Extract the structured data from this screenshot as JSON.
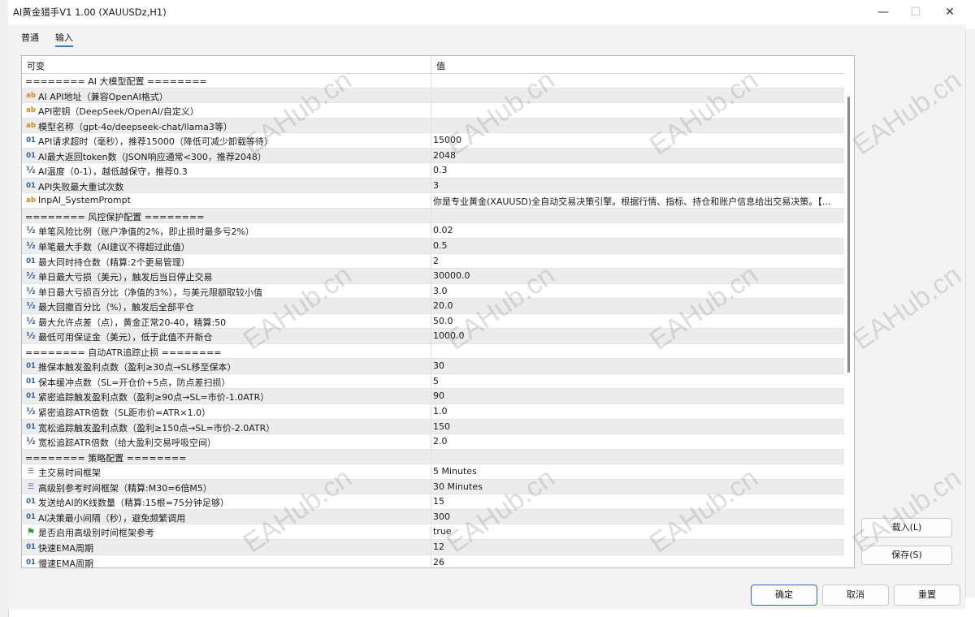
{
  "window": {
    "title": "AI黄金猎手V1 1.00 (XAUUSDz,H1)"
  },
  "tabs": [
    {
      "label": "普通"
    },
    {
      "label": "输入"
    }
  ],
  "grid": {
    "col_name": "可变",
    "col_value": "值",
    "rows": [
      {
        "type": "sep",
        "icon": "",
        "name": "======== AI 大模型配置 ========",
        "value": ""
      },
      {
        "type": "ab",
        "icon": "ab",
        "name": "AI API地址（兼容OpenAI格式）",
        "value": ""
      },
      {
        "type": "ab",
        "icon": "ab",
        "name": "API密钥（DeepSeek/OpenAI/自定义）",
        "value": ""
      },
      {
        "type": "ab",
        "icon": "ab",
        "name": "模型名称（gpt-4o/deepseek-chat/llama3等）",
        "value": ""
      },
      {
        "type": "n01",
        "icon": "01",
        "name": "API请求超时（毫秒），推荐15000（降低可减少卸载等待）",
        "value": "15000"
      },
      {
        "type": "n01",
        "icon": "01",
        "name": "AI最大返回token数（JSON响应通常<300，推荐2048）",
        "value": "2048"
      },
      {
        "type": "half",
        "icon": "½",
        "name": "AI温度（0-1），越低越保守，推荐0.3",
        "value": "0.3"
      },
      {
        "type": "n01",
        "icon": "01",
        "name": "API失败最大重试次数",
        "value": "3"
      },
      {
        "type": "ab",
        "icon": "ab",
        "name": "InpAI_SystemPrompt",
        "value": "你是专业黄金(XAUUSD)全自动交易决策引擎。根据行情、指标、持仓和账户信息给出交易决策。【..."
      },
      {
        "type": "sep",
        "icon": "",
        "name": "======== 风控保护配置 ========",
        "value": ""
      },
      {
        "type": "half",
        "icon": "½",
        "name": "单笔风险比例（账户净值的2%，即止损时最多亏2%）",
        "value": "0.02"
      },
      {
        "type": "half",
        "icon": "½",
        "name": "单笔最大手数（AI建议不得超过此值）",
        "value": "0.5"
      },
      {
        "type": "n01",
        "icon": "01",
        "name": "最大同时持仓数（精算:2个更易管理）",
        "value": "2"
      },
      {
        "type": "half",
        "icon": "½",
        "name": "单日最大亏损（美元），触发后当日停止交易",
        "value": "30000.0"
      },
      {
        "type": "half",
        "icon": "½",
        "name": "单日最大亏损百分比（净值的3%），与美元限额取较小值",
        "value": "3.0"
      },
      {
        "type": "half",
        "icon": "½",
        "name": "最大回撤百分比（%），触发后全部平仓",
        "value": "20.0"
      },
      {
        "type": "half",
        "icon": "½",
        "name": "最大允许点差（点），黄金正常20-40，精算:50",
        "value": "50.0"
      },
      {
        "type": "half",
        "icon": "½",
        "name": "最低可用保证金（美元），低于此值不开新仓",
        "value": "1000.0"
      },
      {
        "type": "sep",
        "icon": "",
        "name": "======== 自动ATR追踪止损 ========",
        "value": ""
      },
      {
        "type": "n01",
        "icon": "01",
        "name": "推保本触发盈利点数（盈利≥30点→SL移至保本）",
        "value": "30"
      },
      {
        "type": "n01",
        "icon": "01",
        "name": "保本缓冲点数（SL=开仓价+5点，防点差扫损）",
        "value": "5"
      },
      {
        "type": "n01",
        "icon": "01",
        "name": "紧密追踪触发盈利点数（盈利≥90点→SL=市价-1.0ATR）",
        "value": "90"
      },
      {
        "type": "half",
        "icon": "½",
        "name": "紧密追踪ATR倍数（SL距市价=ATR×1.0）",
        "value": "1.0"
      },
      {
        "type": "n01",
        "icon": "01",
        "name": "宽松追踪触发盈利点数（盈利≥150点→SL=市价-2.0ATR）",
        "value": "150"
      },
      {
        "type": "half",
        "icon": "½",
        "name": "宽松追踪ATR倍数（给大盈利交易呼吸空间）",
        "value": "2.0"
      },
      {
        "type": "sep",
        "icon": "",
        "name": "======== 策略配置 ========",
        "value": ""
      },
      {
        "type": "tf",
        "icon": "☰",
        "name": "主交易时间框架",
        "value": "5 Minutes"
      },
      {
        "type": "tf",
        "icon": "☰",
        "name": "高级别参考时间框架（精算:M30=6倍M5）",
        "value": "30 Minutes"
      },
      {
        "type": "n01",
        "icon": "01",
        "name": "发送给AI的K线数量（精算:15根=75分钟足够）",
        "value": "15"
      },
      {
        "type": "n01",
        "icon": "01",
        "name": "AI决策最小间隔（秒），避免频繁调用",
        "value": "300"
      },
      {
        "type": "flag",
        "icon": "⚑",
        "name": "是否启用高级别时间框架参考",
        "value": "true"
      },
      {
        "type": "n01",
        "icon": "01",
        "name": "快速EMA周期",
        "value": "12"
      },
      {
        "type": "n01",
        "icon": "01",
        "name": "慢速EMA周期",
        "value": "26"
      }
    ]
  },
  "buttons": {
    "load": "载入(L)",
    "save": "保存(S)",
    "ok": "确定",
    "cancel": "取消",
    "reset": "重置"
  },
  "watermark": "EAHub.cn",
  "colors": {
    "accent": "#2b6cc4",
    "alt_row": "#ececec"
  }
}
